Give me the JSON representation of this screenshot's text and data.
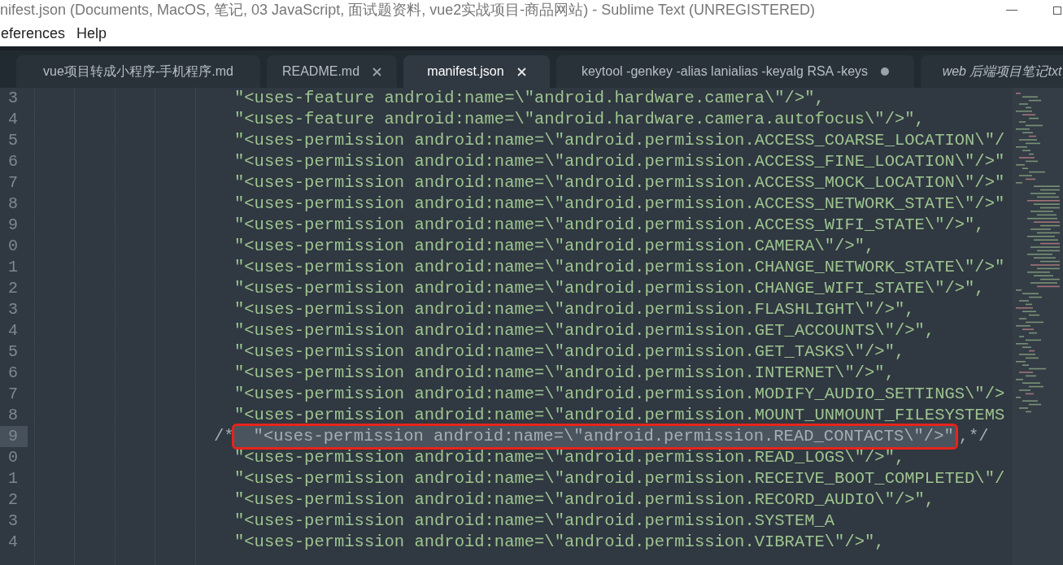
{
  "window": {
    "title": "nifest.json (Documents, MacOS, 笔记, 03 JavaScript, 面试题资料, vue2实战项目-商品网站) - Sublime Text (UNREGISTERED)"
  },
  "menu": [
    "eferences",
    "Help"
  ],
  "tabs": [
    {
      "label": "vue项目转成小程序-手机程序.md",
      "selected": false,
      "dirty": false,
      "closable": false,
      "italic": false
    },
    {
      "label": "README.md",
      "selected": false,
      "dirty": false,
      "closable": true,
      "italic": false
    },
    {
      "label": "manifest.json",
      "selected": true,
      "dirty": false,
      "closable": true,
      "italic": false
    },
    {
      "label": "keytool -genkey -alias lanialias -keyalg RSA -keys",
      "selected": false,
      "dirty": true,
      "closable": false,
      "italic": false
    },
    {
      "label": "web 后端项目笔记txt",
      "selected": false,
      "dirty": false,
      "closable": false,
      "italic": true
    }
  ],
  "lines": [
    {
      "number": "3",
      "kind": "code",
      "text": "\"<uses-feature android:name=\\\"android.hardware.camera\\\"/>\",",
      "current": false,
      "selected": false,
      "annotated": false
    },
    {
      "number": "4",
      "kind": "code",
      "text": "\"<uses-feature android:name=\\\"android.hardware.camera.autofocus\\\"/>\",",
      "current": false,
      "selected": false,
      "annotated": false
    },
    {
      "number": "5",
      "kind": "code",
      "text": "\"<uses-permission android:name=\\\"android.permission.ACCESS_COARSE_LOCATION\\\"/",
      "current": false,
      "selected": false,
      "annotated": false
    },
    {
      "number": "6",
      "kind": "code",
      "text": "\"<uses-permission android:name=\\\"android.permission.ACCESS_FINE_LOCATION\\\"/>\"",
      "current": false,
      "selected": false,
      "annotated": false
    },
    {
      "number": "7",
      "kind": "code",
      "text": "\"<uses-permission android:name=\\\"android.permission.ACCESS_MOCK_LOCATION\\\"/>\"",
      "current": false,
      "selected": false,
      "annotated": false
    },
    {
      "number": "8",
      "kind": "code",
      "text": "\"<uses-permission android:name=\\\"android.permission.ACCESS_NETWORK_STATE\\\"/>\"",
      "current": false,
      "selected": false,
      "annotated": false
    },
    {
      "number": "9",
      "kind": "code",
      "text": "\"<uses-permission android:name=\\\"android.permission.ACCESS_WIFI_STATE\\\"/>\",",
      "current": false,
      "selected": false,
      "annotated": false
    },
    {
      "number": "0",
      "kind": "code",
      "text": "\"<uses-permission android:name=\\\"android.permission.CAMERA\\\"/>\",",
      "current": false,
      "selected": false,
      "annotated": false
    },
    {
      "number": "1",
      "kind": "code",
      "text": "\"<uses-permission android:name=\\\"android.permission.CHANGE_NETWORK_STATE\\\"/>\"",
      "current": false,
      "selected": false,
      "annotated": false
    },
    {
      "number": "2",
      "kind": "code",
      "text": "\"<uses-permission android:name=\\\"android.permission.CHANGE_WIFI_STATE\\\"/>\",",
      "current": false,
      "selected": false,
      "annotated": false
    },
    {
      "number": "3",
      "kind": "code",
      "text": "\"<uses-permission android:name=\\\"android.permission.FLASHLIGHT\\\"/>\",",
      "current": false,
      "selected": false,
      "annotated": false
    },
    {
      "number": "4",
      "kind": "code",
      "text": "\"<uses-permission android:name=\\\"android.permission.GET_ACCOUNTS\\\"/>\",",
      "current": false,
      "selected": false,
      "annotated": false
    },
    {
      "number": "5",
      "kind": "code",
      "text": "\"<uses-permission android:name=\\\"android.permission.GET_TASKS\\\"/>\",",
      "current": false,
      "selected": false,
      "annotated": false
    },
    {
      "number": "6",
      "kind": "code",
      "text": "\"<uses-permission android:name=\\\"android.permission.INTERNET\\\"/>\",",
      "current": false,
      "selected": false,
      "annotated": false
    },
    {
      "number": "7",
      "kind": "code",
      "text": "\"<uses-permission android:name=\\\"android.permission.MODIFY_AUDIO_SETTINGS\\\"/>",
      "current": false,
      "selected": false,
      "annotated": false
    },
    {
      "number": "8",
      "kind": "code",
      "text": "\"<uses-permission android:name=\\\"android.permission.MOUNT_UNMOUNT_FILESYSTEMS",
      "current": false,
      "selected": false,
      "annotated": false
    },
    {
      "number": "9",
      "kind": "commented",
      "prefix": "/*",
      "text": "\"<uses-permission android:name=\\\"android.permission.READ_CONTACTS\\\"/>\"",
      "suffix": ",*/",
      "current": true,
      "selected": true,
      "annotated": true
    },
    {
      "number": "0",
      "kind": "code",
      "text": "\"<uses-permission android:name=\\\"android.permission.READ_LOGS\\\"/>\",",
      "current": false,
      "selected": false,
      "annotated": false
    },
    {
      "number": "1",
      "kind": "code",
      "text": "\"<uses-permission android:name=\\\"android.permission.RECEIVE_BOOT_COMPLETED\\\"/",
      "current": false,
      "selected": false,
      "annotated": false
    },
    {
      "number": "2",
      "kind": "code",
      "text": "\"<uses-permission android:name=\\\"android.permission.RECORD_AUDIO\\\"/>\",",
      "current": false,
      "selected": false,
      "annotated": false
    },
    {
      "number": "3",
      "kind": "code",
      "text": "\"<uses-permission android:name=\\\"android.permission.SYSTEM_A",
      "current": false,
      "selected": false,
      "annotated": false
    },
    {
      "number": "4",
      "kind": "code",
      "text": "\"<uses-permission android:name=\\\"android.permission.VIBRATE\\\"/>\",",
      "current": false,
      "selected": false,
      "annotated": false
    }
  ]
}
